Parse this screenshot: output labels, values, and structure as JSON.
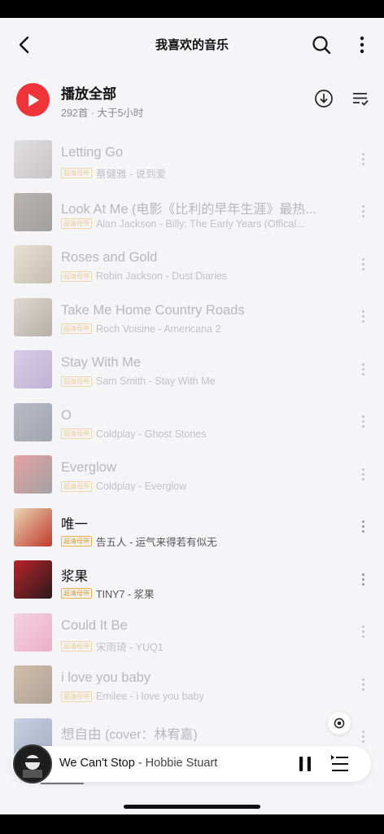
{
  "header": {
    "title": "我喜欢的音乐"
  },
  "play_all": {
    "label": "播放全部",
    "count_text": "292首 · 大于5小时"
  },
  "badge_text": "超清母带",
  "songs": [
    {
      "title": "Letting Go",
      "subtitle": "",
      "artist": "蔡健雅 - 说到爱",
      "state": "dim",
      "cover": [
        "#c8c5c2",
        "#8f8a87"
      ]
    },
    {
      "title": "Look At Me",
      "subtitle": " (电影《比利的早年生涯》最热...",
      "artist": "Alan Jackson - Billy: The Early Years (Offical...",
      "state": "dim",
      "cover": [
        "#6e6255",
        "#3d3a36"
      ]
    },
    {
      "title": "Roses and Gold",
      "subtitle": "",
      "artist": "Robin Jackson - Dust Diaries",
      "state": "dim",
      "cover": [
        "#d8c8a8",
        "#8b7a5a"
      ]
    },
    {
      "title": "Take Me Home Country Roads",
      "subtitle": "",
      "artist": "Roch Voisine - Americana 2",
      "state": "dim",
      "cover": [
        "#c6b7a3",
        "#6b5a44"
      ]
    },
    {
      "title": "Stay With Me",
      "subtitle": "",
      "artist": "Sam Smith - Stay With Me",
      "state": "dim",
      "cover": [
        "#b59ad6",
        "#7d5fa8"
      ]
    },
    {
      "title": "O",
      "subtitle": "",
      "artist": "Coldplay - Ghost Stories",
      "state": "dim",
      "cover": [
        "#6d7486",
        "#3d4352"
      ]
    },
    {
      "title": "Everglow",
      "subtitle": "",
      "artist": "Coldplay - Everglow",
      "state": "dim",
      "cover": [
        "#d63a3a",
        "#3c3c3c"
      ]
    },
    {
      "title": "唯一",
      "subtitle": "",
      "artist": "告五人 - 运气来得若有似无",
      "state": "active",
      "cover": [
        "#e9d7b5",
        "#c0392b"
      ]
    },
    {
      "title": "浆果",
      "subtitle": "",
      "artist": "TINY7 - 浆果",
      "state": "active",
      "cover": [
        "#b8242b",
        "#2b1a1a"
      ]
    },
    {
      "title": "Could It Be",
      "subtitle": "",
      "artist": "宋雨琦 - YUQ1",
      "state": "dim",
      "cover": [
        "#f2a6c7",
        "#e05a8a"
      ]
    },
    {
      "title": "i love you baby",
      "subtitle": "",
      "artist": "Emilee - i love you baby",
      "state": "dim",
      "cover": [
        "#a87c4a",
        "#5a3e22"
      ]
    },
    {
      "title": "想自由",
      "subtitle": " (cover：林宥嘉)",
      "artist": "",
      "state": "dim",
      "cover": [
        "#8aa3c7",
        "#4a5d80"
      ]
    }
  ],
  "mini_player": {
    "title": "We Can't Stop",
    "separator": " - ",
    "artist": "Hobbie Stuart"
  },
  "playback_progress": 0.12
}
